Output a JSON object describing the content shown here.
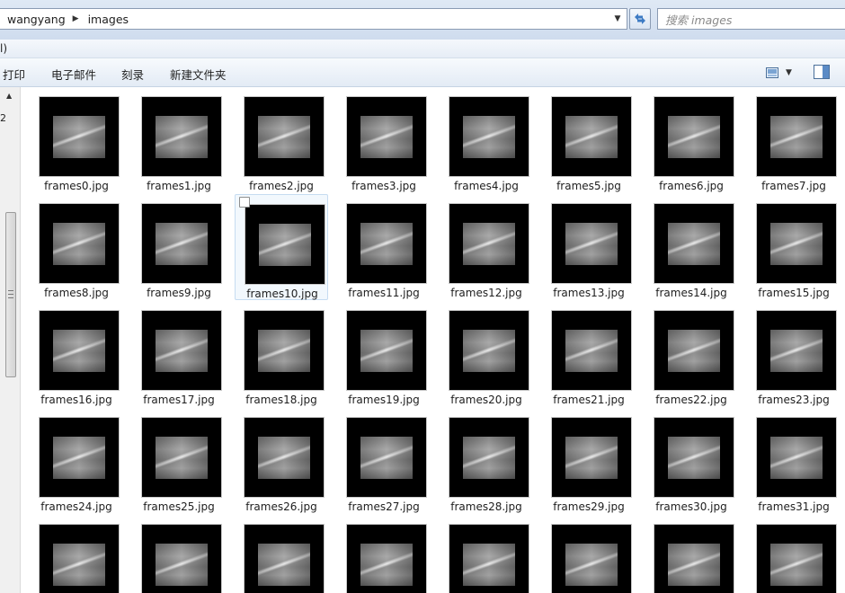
{
  "address": {
    "breadcrumbs": [
      "wangyang",
      "images"
    ]
  },
  "search": {
    "placeholder": "搜索 images"
  },
  "menu": {
    "fragment": "l)"
  },
  "nav_fragment": "2",
  "toolbar": {
    "print_label": "打印",
    "email_label": "电子邮件",
    "burn_label": "刻录",
    "new_folder_label": "新建文件夹"
  },
  "files": [
    "frames0.jpg",
    "frames1.jpg",
    "frames2.jpg",
    "frames3.jpg",
    "frames4.jpg",
    "frames5.jpg",
    "frames6.jpg",
    "frames7.jpg",
    "frames8.jpg",
    "frames9.jpg",
    "frames10.jpg",
    "frames11.jpg",
    "frames12.jpg",
    "frames13.jpg",
    "frames14.jpg",
    "frames15.jpg",
    "frames16.jpg",
    "frames17.jpg",
    "frames18.jpg",
    "frames19.jpg",
    "frames20.jpg",
    "frames21.jpg",
    "frames22.jpg",
    "frames23.jpg",
    "frames24.jpg",
    "frames25.jpg",
    "frames26.jpg",
    "frames27.jpg",
    "frames28.jpg",
    "frames29.jpg",
    "frames30.jpg",
    "frames31.jpg",
    "",
    "",
    "",
    "",
    "",
    "",
    "",
    ""
  ],
  "hovered_file_index": 10,
  "colors": {
    "chrome": "#dfe9f5",
    "selection": "#f2f8fd"
  }
}
